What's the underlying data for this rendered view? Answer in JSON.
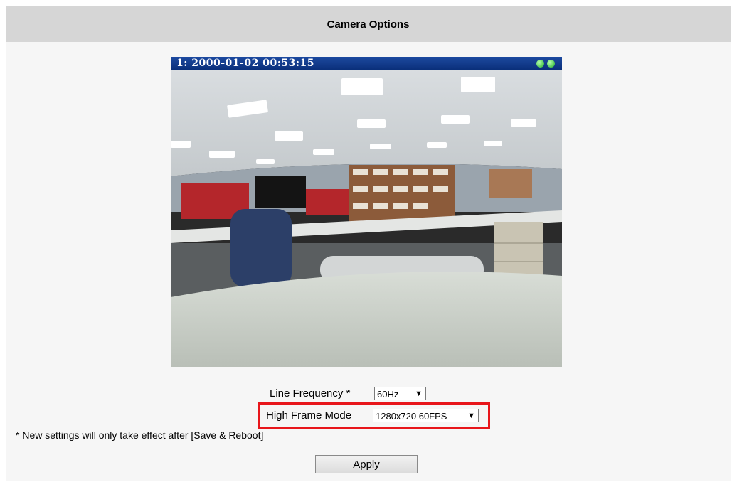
{
  "header": {
    "title": "Camera Options"
  },
  "video": {
    "osd_text": "1:  2000-01-02 00:53:15"
  },
  "form": {
    "line_frequency": {
      "label": "Line Frequency  *",
      "value": "60Hz"
    },
    "high_frame_mode": {
      "label": "High Frame Mode",
      "value": "1280x720 60FPS"
    }
  },
  "note": "* New settings will only take effect after [Save & Reboot]",
  "apply_label": "Apply",
  "colors": {
    "highlight": "#e8161b",
    "header_bg": "#d6d6d6",
    "osd_bar": "#1d4aa0"
  }
}
